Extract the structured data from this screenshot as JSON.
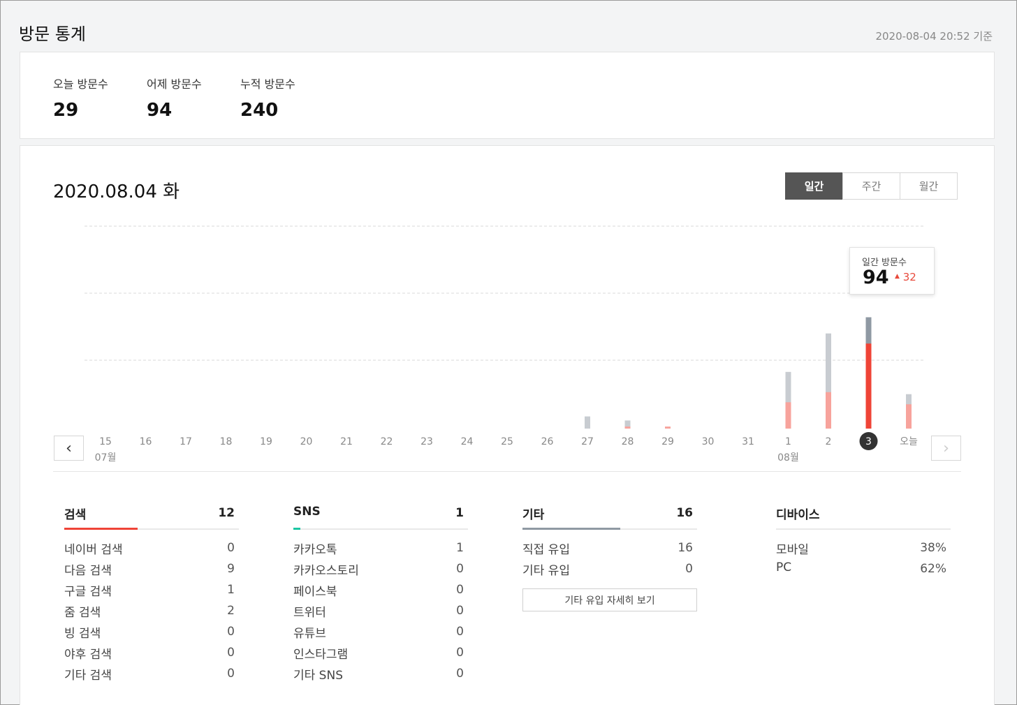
{
  "header": {
    "title": "방문 통계",
    "timestamp": "2020-08-04 20:52 기준"
  },
  "summary": [
    {
      "label": "오늘 방문수",
      "value": "29"
    },
    {
      "label": "어제 방문수",
      "value": "94"
    },
    {
      "label": "누적 방문수",
      "value": "240"
    }
  ],
  "main": {
    "date_title": "2020.08.04 화",
    "period_tabs": [
      {
        "label": "일간",
        "active": true
      },
      {
        "label": "주간",
        "active": false
      },
      {
        "label": "월간",
        "active": false
      }
    ],
    "prev_icon": "chevron-left-icon",
    "next_icon": "chevron-right-icon"
  },
  "tooltip": {
    "label": "일간 방문수",
    "value": "94",
    "diff": "32",
    "diff_icon": "up-triangle-icon"
  },
  "chart_data": {
    "type": "bar",
    "categories": [
      "15",
      "16",
      "17",
      "18",
      "19",
      "20",
      "21",
      "22",
      "23",
      "24",
      "25",
      "26",
      "27",
      "28",
      "29",
      "30",
      "31",
      "1",
      "2",
      "3",
      "오늘"
    ],
    "month_labels": [
      {
        "index": 0,
        "label": "07월"
      },
      {
        "index": 17,
        "label": "08월"
      }
    ],
    "selected_index": 19,
    "series": [
      {
        "values": [
          0,
          0,
          0,
          0,
          0,
          0,
          0,
          0,
          0,
          0,
          0,
          0,
          6,
          4,
          0,
          0,
          0,
          28,
          47,
          55,
          17
        ]
      },
      {
        "values": [
          0,
          0,
          0,
          0,
          0,
          0,
          0,
          0,
          0,
          0,
          0,
          0,
          0,
          1,
          1,
          0,
          0,
          13,
          18,
          42,
          12
        ]
      }
    ],
    "colors": {
      "total_normal": "#c8ccd1",
      "total_selected": "#8f99a3",
      "new_normal": "#f7a39c",
      "new_selected": "#ef4437",
      "selected_label_bg": "#333333"
    },
    "ylim": [
      0,
      100
    ],
    "grid": true
  },
  "stats": {
    "search": {
      "title": "검색",
      "total": "12",
      "bar_fraction": 0.42,
      "bar_color": "#ef4437",
      "rows": [
        {
          "name": "네이버 검색",
          "value": "0"
        },
        {
          "name": "다음 검색",
          "value": "9"
        },
        {
          "name": "구글 검색",
          "value": "1"
        },
        {
          "name": "줌 검색",
          "value": "2"
        },
        {
          "name": "빙 검색",
          "value": "0"
        },
        {
          "name": "야후 검색",
          "value": "0"
        },
        {
          "name": "기타 검색",
          "value": "0"
        }
      ]
    },
    "sns": {
      "title": "SNS",
      "total": "1",
      "bar_fraction": 0.04,
      "bar_color": "#1cc6a3",
      "rows": [
        {
          "name": "카카오톡",
          "value": "1"
        },
        {
          "name": "카카오스토리",
          "value": "0"
        },
        {
          "name": "페이스북",
          "value": "0"
        },
        {
          "name": "트위터",
          "value": "0"
        },
        {
          "name": "유튜브",
          "value": "0"
        },
        {
          "name": "인스타그램",
          "value": "0"
        },
        {
          "name": "기타 SNS",
          "value": "0"
        }
      ]
    },
    "etc": {
      "title": "기타",
      "total": "16",
      "bar_fraction": 0.56,
      "bar_color": "#8f99a3",
      "rows": [
        {
          "name": "직접 유입",
          "value": "16"
        },
        {
          "name": "기타 유입",
          "value": "0"
        }
      ],
      "detail_button": "기타 유입 자세히 보기"
    },
    "device": {
      "title": "디바이스",
      "rows": [
        {
          "name": "모바일",
          "value": "38%"
        },
        {
          "name": "PC",
          "value": "62%"
        }
      ]
    }
  }
}
